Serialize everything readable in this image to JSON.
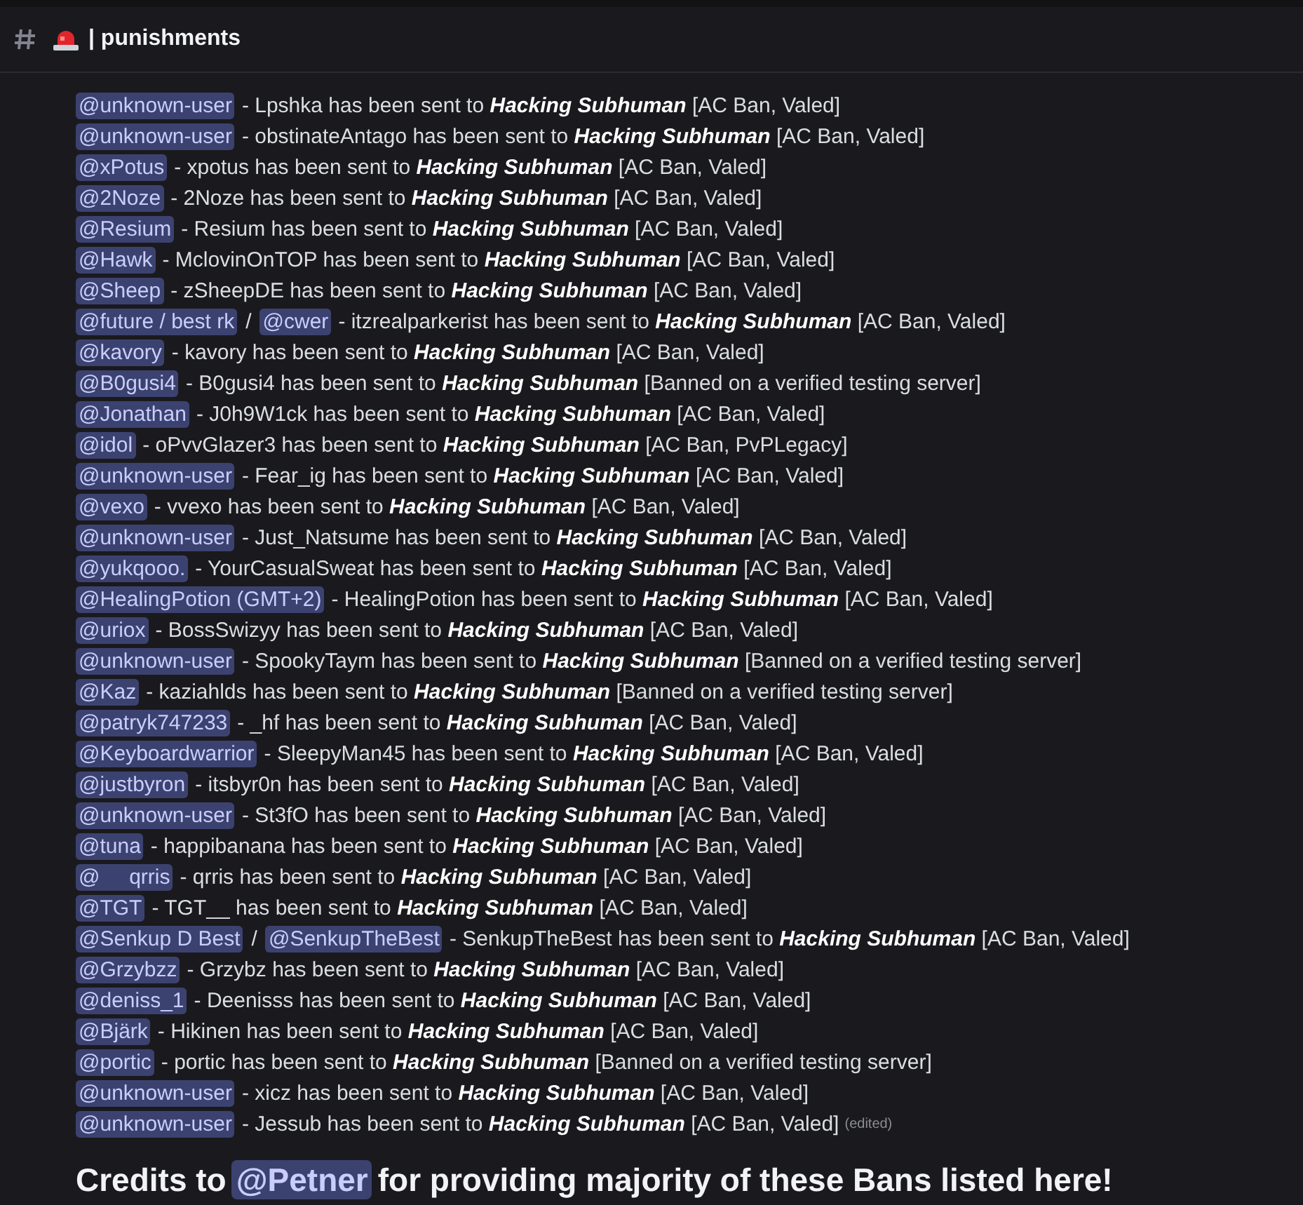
{
  "channel": {
    "name": "| punishments"
  },
  "entries": [
    {
      "mentions": [
        "@unknown-user"
      ],
      "text": "- Lpshka has been sent to",
      "rank": "Hacking Subhuman",
      "reason": "[AC Ban, Valed]"
    },
    {
      "mentions": [
        "@unknown-user"
      ],
      "text": "- obstinateAntago has been sent to",
      "rank": "Hacking Subhuman",
      "reason": "[AC Ban, Valed]"
    },
    {
      "mentions": [
        "@xPotus"
      ],
      "text": "- xpotus has been sent to",
      "rank": "Hacking Subhuman",
      "reason": "[AC Ban, Valed]"
    },
    {
      "mentions": [
        "@2Noze"
      ],
      "text": "- 2Noze has been sent to",
      "rank": "Hacking Subhuman",
      "reason": "[AC Ban, Valed]"
    },
    {
      "mentions": [
        "@Resium"
      ],
      "text": "- Resium has been sent to",
      "rank": "Hacking Subhuman",
      "reason": "[AC Ban, Valed]"
    },
    {
      "mentions": [
        "@Hawk"
      ],
      "text": "- MclovinOnTOP has been sent to",
      "rank": "Hacking Subhuman",
      "reason": "[AC Ban, Valed]"
    },
    {
      "mentions": [
        "@Sheep"
      ],
      "text": "- zSheepDE has been sent to",
      "rank": "Hacking Subhuman",
      "reason": "[AC Ban, Valed]"
    },
    {
      "mentions": [
        "@future / best rk",
        "@cwer"
      ],
      "separator": "/",
      "text": "- itzrealparkerist has been sent to",
      "rank": "Hacking Subhuman",
      "reason": "[AC Ban, Valed]"
    },
    {
      "mentions": [
        "@kavory"
      ],
      "text": "- kavory has been sent to",
      "rank": "Hacking Subhuman",
      "reason": "[AC Ban, Valed]"
    },
    {
      "mentions": [
        "@B0gusi4"
      ],
      "text": "- B0gusi4 has been sent to",
      "rank": "Hacking Subhuman",
      "reason": "[Banned on a verified testing server]"
    },
    {
      "mentions": [
        "@Jonathan"
      ],
      "text": "- J0h9W1ck has been sent to",
      "rank": "Hacking Subhuman",
      "reason": "[AC Ban, Valed]"
    },
    {
      "mentions": [
        "@idol"
      ],
      "text": "- oPvvGlazer3 has been sent to",
      "rank": "Hacking Subhuman",
      "reason": "[AC Ban, PvPLegacy]"
    },
    {
      "mentions": [
        "@unknown-user"
      ],
      "text": "- Fear_ig has been sent to",
      "rank": "Hacking Subhuman",
      "reason": "[AC Ban, Valed]"
    },
    {
      "mentions": [
        "@vexo"
      ],
      "text": "- vvexo has been sent to",
      "rank": "Hacking Subhuman",
      "reason": "[AC Ban, Valed]"
    },
    {
      "mentions": [
        "@unknown-user"
      ],
      "text": "- Just_Natsume has been sent to",
      "rank": "Hacking Subhuman",
      "reason": "[AC Ban, Valed]"
    },
    {
      "mentions": [
        "@yukqooo."
      ],
      "text": "- YourCasualSweat has been sent to",
      "rank": "Hacking Subhuman",
      "reason": "[AC Ban, Valed]"
    },
    {
      "mentions": [
        "@HealingPotion (GMT+2)"
      ],
      "text": "- HealingPotion has been sent to",
      "rank": "Hacking Subhuman",
      "reason": "[AC Ban, Valed]"
    },
    {
      "mentions": [
        "@uriox"
      ],
      "text": "- BossSwizyy has been sent to",
      "rank": "Hacking Subhuman",
      "reason": "[AC Ban, Valed]"
    },
    {
      "mentions": [
        "@unknown-user"
      ],
      "text": "- SpookyTaym has been sent to",
      "rank": "Hacking Subhuman",
      "reason": "[Banned on a verified testing server]"
    },
    {
      "mentions": [
        "@Kaz"
      ],
      "text": "- kaziahlds has been sent to",
      "rank": "Hacking Subhuman",
      "reason": "[Banned on a verified testing server]"
    },
    {
      "mentions": [
        "@patryk747233"
      ],
      "text": "- _hf has been sent to",
      "rank": "Hacking Subhuman",
      "reason": "[AC Ban, Valed]"
    },
    {
      "mentions": [
        "@Keyboardwarrior"
      ],
      "text": "- SleepyMan45 has been sent to",
      "rank": "Hacking Subhuman",
      "reason": "[AC Ban, Valed]"
    },
    {
      "mentions": [
        "@justbyron"
      ],
      "text": "- itsbyr0n has been sent to",
      "rank": "Hacking Subhuman",
      "reason": "[AC Ban, Valed]"
    },
    {
      "mentions": [
        "@unknown-user"
      ],
      "text": "- St3fO has been sent to",
      "rank": "Hacking Subhuman",
      "reason": "[AC Ban, Valed]"
    },
    {
      "mentions": [
        "@tuna"
      ],
      "text": "- happibanana has been sent to",
      "rank": "Hacking Subhuman",
      "reason": "[AC Ban, Valed]"
    },
    {
      "mentions": [
        "@     qrris"
      ],
      "text": "- qrris has been sent to",
      "rank": "Hacking Subhuman",
      "reason": "[AC Ban, Valed]"
    },
    {
      "mentions": [
        "@TGT"
      ],
      "text": "- TGT__ has been sent to",
      "rank": "Hacking Subhuman",
      "reason": "[AC Ban, Valed]"
    },
    {
      "mentions": [
        "@Senkup D Best",
        "@SenkupTheBest"
      ],
      "separator": "/",
      "text": "- SenkupTheBest has been sent to",
      "rank": "Hacking Subhuman",
      "reason": "[AC Ban, Valed]"
    },
    {
      "mentions": [
        "@Grzybzz"
      ],
      "text": "- Grzybz has been sent to",
      "rank": "Hacking Subhuman",
      "reason": "[AC Ban, Valed]"
    },
    {
      "mentions": [
        "@deniss_1"
      ],
      "text": "- Deenisss has been sent to",
      "rank": "Hacking Subhuman",
      "reason": "[AC Ban, Valed]"
    },
    {
      "mentions": [
        "@Bjärk"
      ],
      "text": "- Hikinen has been sent to",
      "rank": "Hacking Subhuman",
      "reason": "[AC Ban, Valed]"
    },
    {
      "mentions": [
        "@portic"
      ],
      "text": "- portic has been sent to",
      "rank": "Hacking Subhuman",
      "reason": "[Banned on a verified testing server]"
    },
    {
      "mentions": [
        "@unknown-user"
      ],
      "text": "- xicz has been sent to",
      "rank": "Hacking Subhuman",
      "reason": "[AC Ban, Valed]"
    },
    {
      "mentions": [
        "@unknown-user"
      ],
      "text": "- Jessub has been sent to",
      "rank": "Hacking Subhuman",
      "reason": "[AC Ban, Valed]",
      "edited": "(edited)"
    }
  ],
  "credits": {
    "prefix": "Credits to",
    "mention": "@Petner",
    "suffix": "for providing majority of these Bans listed here!"
  }
}
